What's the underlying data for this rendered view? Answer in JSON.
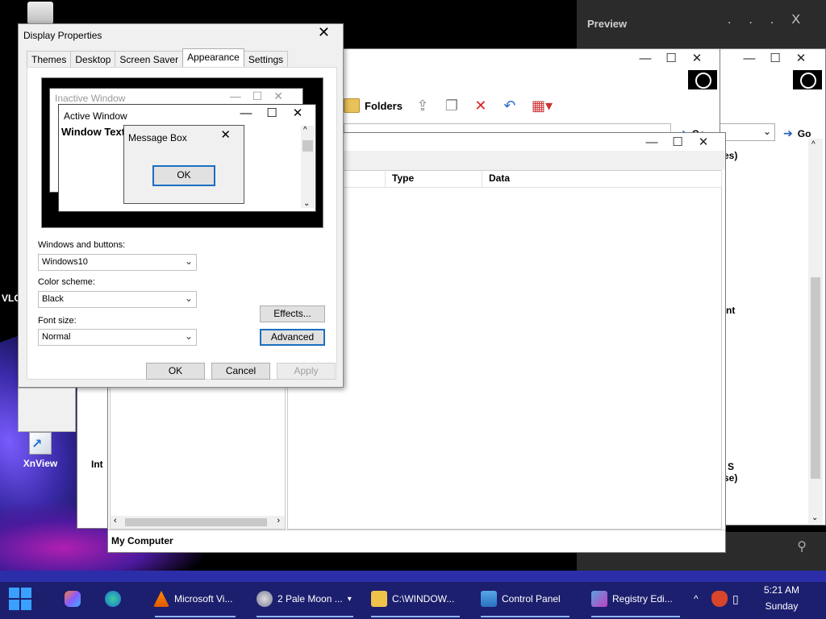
{
  "desktop": {
    "icons": [
      "XnView"
    ],
    "partial_labels": {
      "vl": "VLC",
      "int": "Int"
    }
  },
  "preview_pane": {
    "title": "Preview",
    "buttons": [
      "...",
      "X"
    ]
  },
  "explorer": {
    "toolbar": {
      "folders_label": "Folders"
    },
    "go_label": "Go",
    "partial_texts": [
      "es)",
      "nt",
      "S",
      "se)"
    ]
  },
  "registry": {
    "columns": [
      "",
      "Type",
      "Data"
    ],
    "status": "My Computer"
  },
  "display_properties": {
    "title": "Display Properties",
    "tabs": [
      "Themes",
      "Desktop",
      "Screen Saver",
      "Appearance",
      "Settings"
    ],
    "active_tab": "Appearance",
    "preview": {
      "inactive_title": "Inactive Window",
      "active_title": "Active Window",
      "window_text": "Window Text",
      "msgbox_title": "Message Box",
      "msgbox_ok": "OK"
    },
    "windows_and_buttons": {
      "label": "Windows and buttons:",
      "value": "Windows10"
    },
    "color_scheme": {
      "label": "Color scheme:",
      "value": "Black"
    },
    "font_size": {
      "label": "Font size:",
      "value": "Normal"
    },
    "effects_label": "Effects...",
    "advanced_label": "Advanced",
    "ok_label": "OK",
    "cancel_label": "Cancel",
    "apply_label": "Apply"
  },
  "taskbar": {
    "items": [
      {
        "label": "Microsoft Vi..."
      },
      {
        "label": "2 Pale Moon ..."
      },
      {
        "label": "C:\\WINDOW..."
      },
      {
        "label": "Control Panel"
      },
      {
        "label": "Registry Edi..."
      }
    ],
    "clock": {
      "time": "5:21 AM",
      "day": "Sunday"
    }
  }
}
